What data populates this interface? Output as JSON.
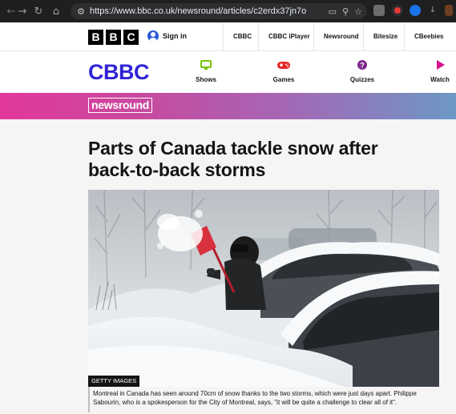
{
  "browser": {
    "url": "https://www.bbc.co.uk/newsround/articles/c2erdx37jn7o",
    "back_icon": "arrow-left",
    "forward_icon": "arrow-right",
    "reload_icon": "reload",
    "home_icon": "home",
    "tune_icon": "site-settings",
    "url_icons": [
      "install-app",
      "zoom",
      "bookmark-star"
    ]
  },
  "bbc_bar": {
    "logo_letters": [
      "B",
      "B",
      "C"
    ],
    "signin_label": "Sign in",
    "links": [
      "CBBC",
      "CBBC iPlayer",
      "Newsround",
      "Bitesize",
      "CBeebies"
    ]
  },
  "cbbc_nav": {
    "logo": "CBBC",
    "items": [
      {
        "label": "Shows",
        "icon": "tv-icon",
        "color": "#7ac70c"
      },
      {
        "label": "Games",
        "icon": "gamepad-icon",
        "color": "#e5282a"
      },
      {
        "label": "Quizzes",
        "icon": "quiz-icon",
        "color": "#7c2a8c"
      },
      {
        "label": "Watch",
        "icon": "play-icon",
        "color": "#d4148e"
      }
    ]
  },
  "newsround": {
    "logo": "newsround",
    "gradient": [
      "#e2389b",
      "#6c98c4"
    ]
  },
  "article": {
    "headline": "Parts of Canada tackle snow after back-to-back storms",
    "image_credit": "GETTY IMAGES",
    "caption": "Montreal in Canada has seen around 70cm of snow thanks to the two storms, which were just days apart. Philippe Sabourin, who is a spokesperson for the City of Montreal, says, \"it will be quite a challenge to clear all of it\"."
  },
  "colors": {
    "cbbc_blue": "#3024d6",
    "chrome_bg": "#1f1f1f"
  }
}
